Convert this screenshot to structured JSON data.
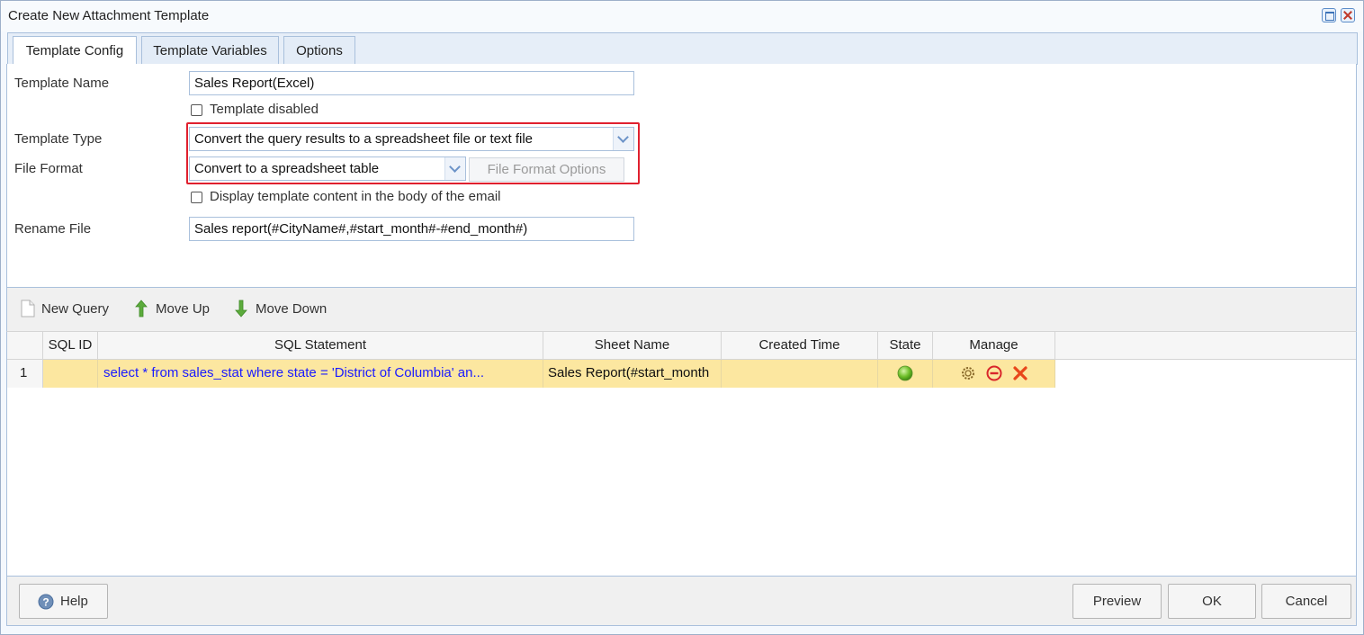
{
  "window": {
    "title": "Create New Attachment Template"
  },
  "tabs": [
    {
      "label": "Template Config"
    },
    {
      "label": "Template Variables"
    },
    {
      "label": "Options"
    }
  ],
  "form": {
    "template_name_label": "Template Name",
    "template_name_value": "Sales Report(Excel)",
    "template_disabled_label": "Template disabled",
    "template_disabled_checked": false,
    "template_type_label": "Template Type",
    "template_type_value": "Convert the query results to a spreadsheet file or text file",
    "file_format_label": "File Format",
    "file_format_value": "Convert to a spreadsheet table",
    "file_format_options_label": "File Format Options",
    "display_in_body_label": "Display template content in the body of the email",
    "display_in_body_checked": false,
    "rename_file_label": "Rename File",
    "rename_file_value": "Sales report(#CityName#,#start_month#-#end_month#)"
  },
  "toolbar": {
    "new_query": "New Query",
    "move_up": "Move Up",
    "move_down": "Move Down"
  },
  "grid": {
    "columns": [
      "SQL ID",
      "SQL Statement",
      "Sheet Name",
      "Created Time",
      "State",
      "Manage"
    ],
    "rows": [
      {
        "row_number": "1",
        "sql_id": "",
        "sql_statement": "select * from sales_stat where state = 'District of Columbia' an...",
        "sheet_name": "Sales Report(#start_month",
        "created_time": "",
        "state": "green-dot-icon"
      }
    ]
  },
  "footer": {
    "help": "Help",
    "preview": "Preview",
    "ok": "OK",
    "cancel": "Cancel"
  },
  "colors": {
    "highlight_row": "#fce7a0",
    "sql_text": "#1a1aff",
    "annotation_border": "#e0202e"
  }
}
